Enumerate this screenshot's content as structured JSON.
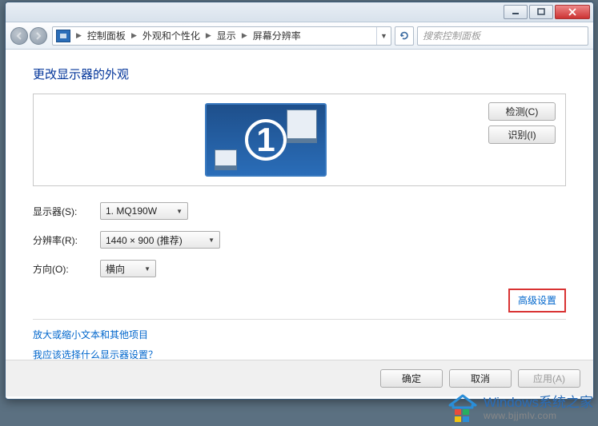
{
  "breadcrumb": {
    "segments": [
      "控制面板",
      "外观和个性化",
      "显示",
      "屏幕分辨率"
    ]
  },
  "search": {
    "placeholder": "搜索控制面板"
  },
  "heading": "更改显示器的外观",
  "monitor_number": "1",
  "side_buttons": {
    "detect": "检测(C)",
    "identify": "识别(I)"
  },
  "form": {
    "monitor_label": "显示器(S):",
    "monitor_value": "1. MQ190W",
    "resolution_label": "分辨率(R):",
    "resolution_value": "1440 × 900 (推荐)",
    "orientation_label": "方向(O):",
    "orientation_value": "横向"
  },
  "advanced_link": "高级设置",
  "links": {
    "text_size": "放大或缩小文本和其他项目",
    "which_monitor": "我应该选择什么显示器设置？"
  },
  "footer": {
    "ok": "确定",
    "cancel": "取消",
    "apply": "应用(A)"
  },
  "watermark": {
    "title": "Windows系统之家",
    "sub": "www.bjjmlv.com"
  }
}
